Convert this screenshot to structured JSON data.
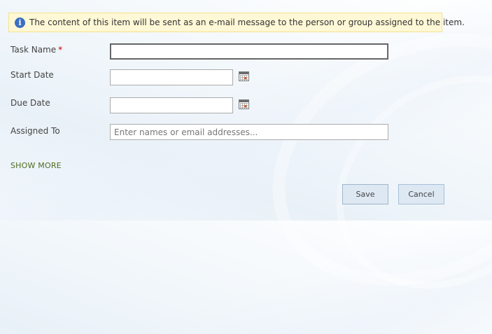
{
  "info_bar": {
    "icon": "info-icon",
    "icon_glyph": "i",
    "message": "The content of this item will be sent as an e-mail message to the person or group assigned to the item."
  },
  "form": {
    "task_name": {
      "label": "Task Name",
      "required_marker": "*",
      "value": ""
    },
    "start_date": {
      "label": "Start Date",
      "value": "",
      "picker_icon": "calendar-icon"
    },
    "due_date": {
      "label": "Due Date",
      "value": "",
      "picker_icon": "calendar-icon"
    },
    "assigned_to": {
      "label": "Assigned To",
      "placeholder": "Enter names or email addresses...",
      "value": ""
    },
    "show_more_label": "SHOW MORE"
  },
  "actions": {
    "save_label": "Save",
    "cancel_label": "Cancel"
  },
  "colors": {
    "info_background": "#fff8d6",
    "info_icon": "#3c6fc1",
    "required_star": "#bf0000",
    "show_more_link": "#4e6b1f",
    "button_background": "#dde8f3"
  }
}
